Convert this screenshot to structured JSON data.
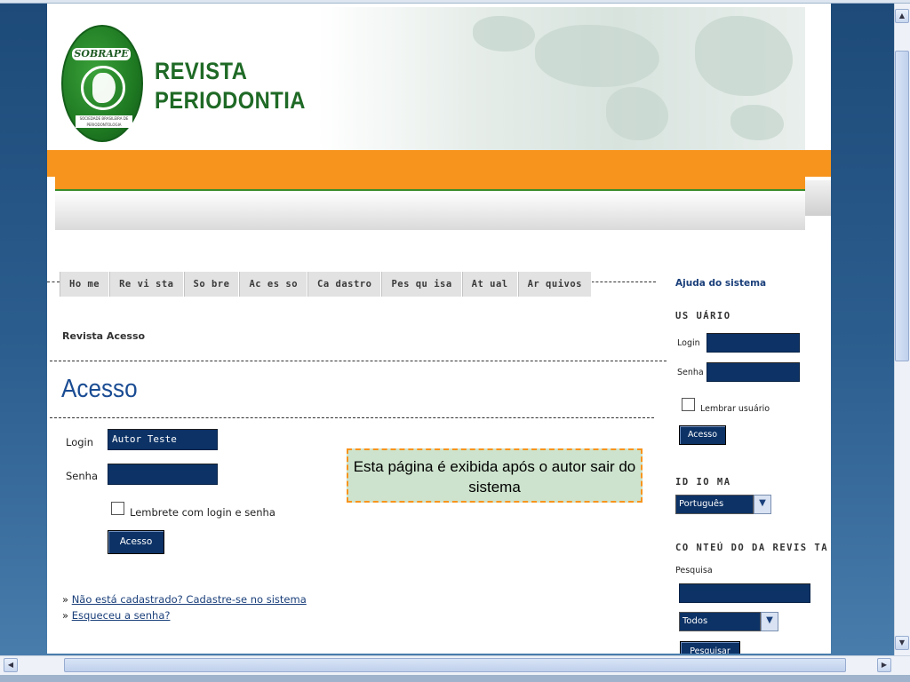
{
  "header": {
    "logo_text": "SOBRAPE",
    "logo_subtext": "SOCIEDADE BRASILEIRA DE PERIODONTOLOGIA",
    "brand_line1": "REVISTA",
    "brand_line2": "PERIODONTIA"
  },
  "nav": {
    "items": [
      "Ho me",
      "Re vi sta",
      "So bre",
      "Ac es so",
      "Ca dastro",
      "Pes qu isa",
      "At ual",
      "Ar quivos"
    ]
  },
  "breadcrumb": "Revista Acesso",
  "page_title": "Acesso",
  "form": {
    "login_label": "Login",
    "login_value": "Autor Teste",
    "password_label": "Senha",
    "password_value": "",
    "remember_label": "Lembrete com login e senha",
    "submit_label": "Acesso"
  },
  "links": {
    "register": "Não está cadastrado? Cadastre-se no sistema",
    "forgot": "Esqueceu a senha?",
    "bullet": "»"
  },
  "note": "Esta página é exibida após o autor sair do sistema",
  "sidebar": {
    "help_link": "Ajuda do sistema",
    "user_title": "US UÁRIO",
    "login_label": "Login",
    "password_label": "Senha",
    "remember_label": "Lembrar usuário",
    "login_button": "Acesso",
    "language_title": "ID IO MA",
    "language_value": "Português (Brasil)",
    "content_title": "CO NTEÚ DO  DA  REVIS TA",
    "search_label": "Pesquisa",
    "search_value": "",
    "scope_value": "Todos",
    "search_button": "Pesquisar"
  },
  "colors": {
    "brand_green": "#1f6a26",
    "orange": "#f7941d",
    "input_navy": "#0c3266",
    "title_blue": "#1a4c93",
    "note_bg": "#cde3cd"
  }
}
